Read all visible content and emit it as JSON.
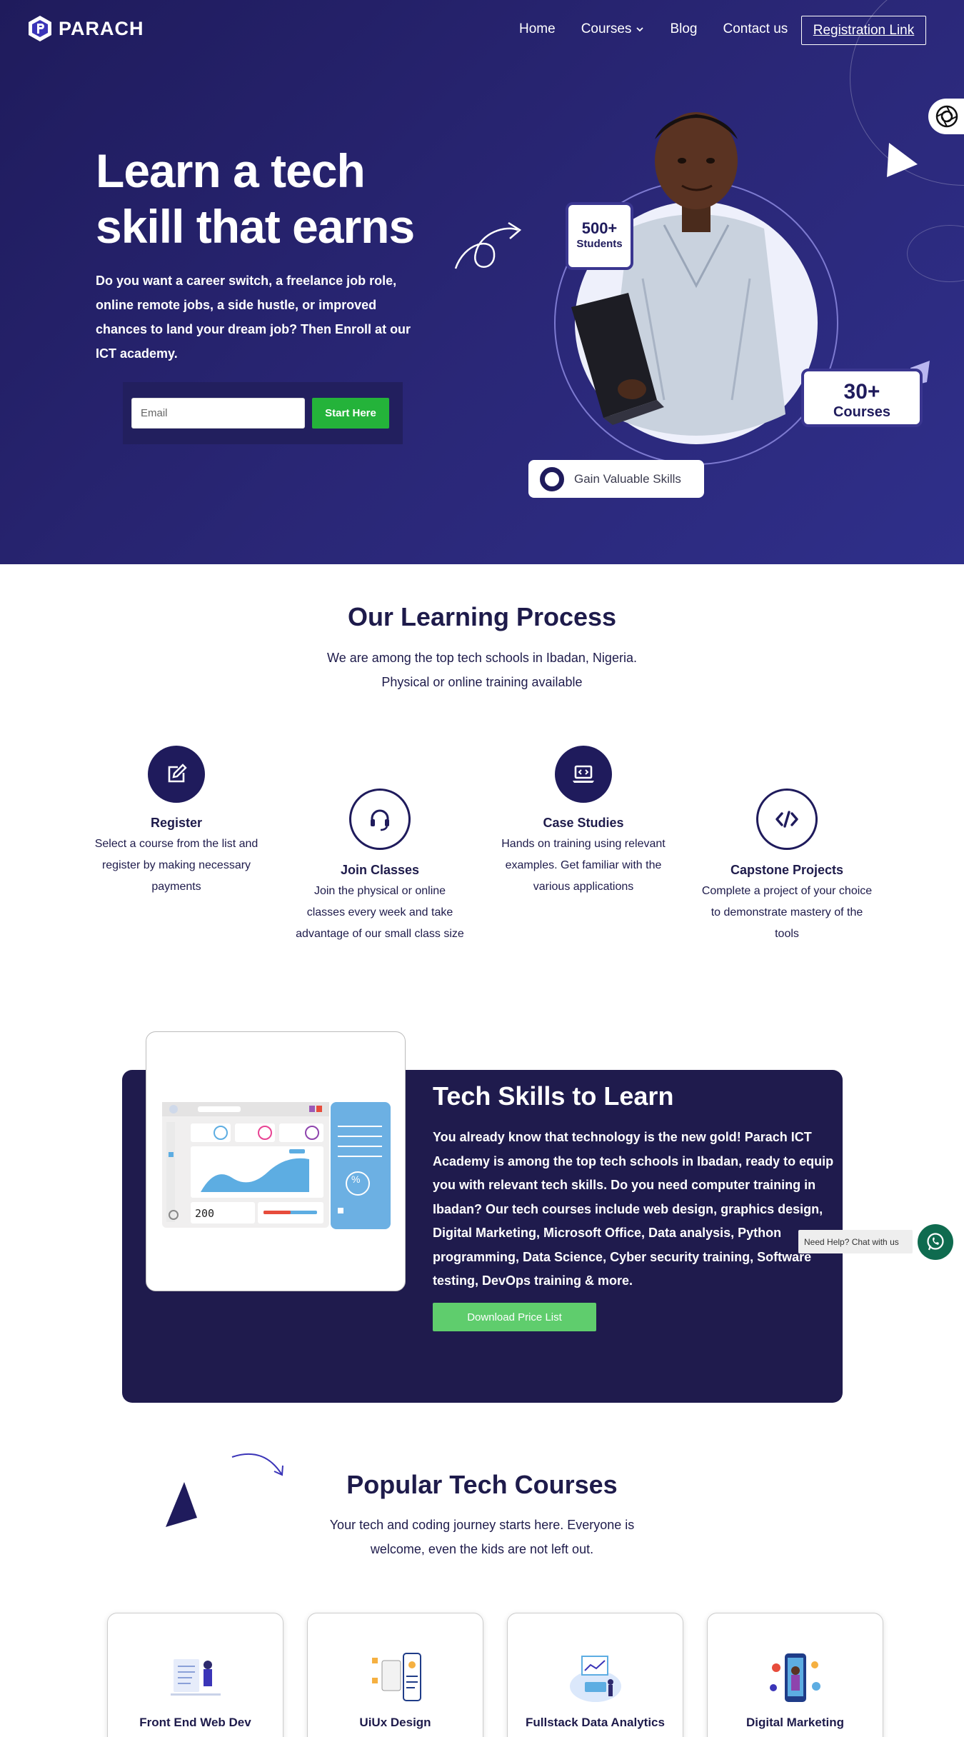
{
  "brand": {
    "name": "PARACH"
  },
  "nav": {
    "items": [
      {
        "label": "Home"
      },
      {
        "label": "Courses"
      },
      {
        "label": "Blog"
      },
      {
        "label": "Contact us"
      }
    ],
    "cta_label": "Registration Link"
  },
  "hero": {
    "title_line1": "Learn a tech",
    "title_line2": "skill that earns",
    "description": "Do you want a career switch, a freelance job role,  online remote jobs, a side hustle, or improved chances to land your dream job?  Then Enroll at our ICT academy.",
    "email_placeholder": "Email",
    "start_label": "Start Here",
    "stat_students_num": "500+",
    "stat_students_label": "Students",
    "stat_courses_num": "30+",
    "stat_courses_label": "Courses",
    "skills_pill": "Gain Valuable Skills"
  },
  "process": {
    "title": "Our Learning Process",
    "subtitle_line1": "We are among the top tech schools in Ibadan, Nigeria.",
    "subtitle_line2": "Physical or online training available",
    "steps": [
      {
        "icon": "edit-icon",
        "title": "Register",
        "text": "Select a course from the list and register by making necessary payments"
      },
      {
        "icon": "headset-icon",
        "title": "Join Classes",
        "text": "Join the physical or online classes every week and take advantage of our small class size"
      },
      {
        "icon": "laptop-code-icon",
        "title": "Case Studies",
        "text": "Hands on training using relevant examples. Get familiar with the various applications"
      },
      {
        "icon": "code-icon",
        "title": "Capstone Projects",
        "text": "Complete a project of your choice to demonstrate mastery of the tools"
      }
    ]
  },
  "skills": {
    "title": "Tech Skills to Learn",
    "text": "You already know that technology is the new gold! Parach ICT Academy is among the top tech schools in Ibadan, ready to equip you with relevant tech skills. Do you need computer training in Ibadan? Our tech courses include web design, graphics design, Digital Marketing, Microsoft Office, Data analysis, Python programming, Data Science, Cyber security training, Software testing, DevOps training & more.",
    "download_label": "Download Price List",
    "dashboard_number": "200"
  },
  "chat": {
    "label": "Need Help? Chat with us"
  },
  "popular": {
    "title": "Popular Tech Courses",
    "subtitle_line1": "Your tech and coding journey starts here. Everyone is",
    "subtitle_line2": "welcome, even the kids are not left out.",
    "courses": [
      {
        "name": "Front End Web Dev"
      },
      {
        "name": "UiUx Design"
      },
      {
        "name": "Fullstack Data Analytics"
      },
      {
        "name": "Digital Marketing"
      }
    ]
  },
  "colors": {
    "navy": "#1f1b5c",
    "hero_bg": "#2a2777",
    "green": "#24b33a",
    "green_light": "#5fcd6d",
    "whatsapp": "#0f6b4f"
  }
}
